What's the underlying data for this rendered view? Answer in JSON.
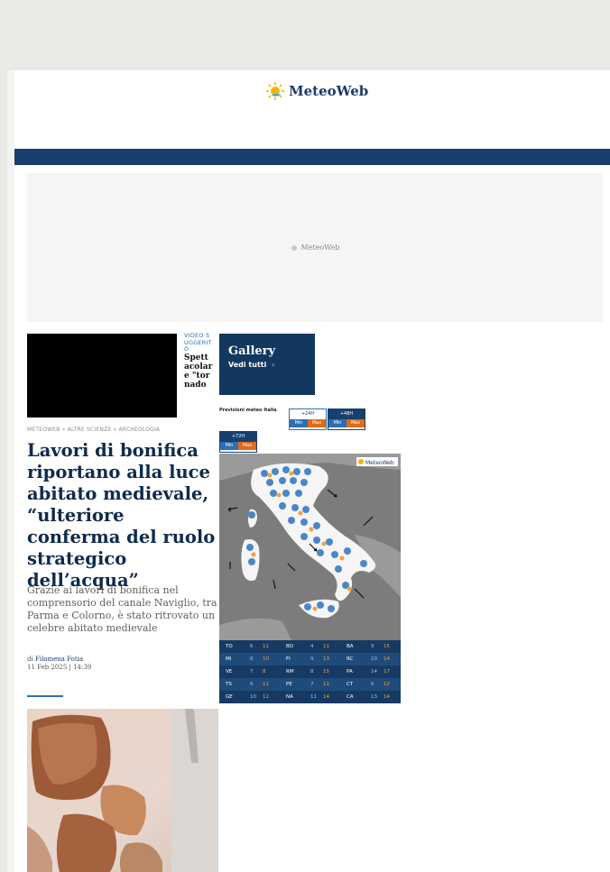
{
  "brand": {
    "name": "MeteoWeb",
    "ad_logo_text": "MeteoWeb",
    "map_logo_text": "MeteoWeb"
  },
  "video_widget": {
    "tag": "VIDEO SUGGERITO",
    "title": "Spettacolare \"tornado"
  },
  "gallery": {
    "title": "Gallery",
    "link": "Vedi tutti",
    "arrow": "›"
  },
  "breadcrumb": "METEOWEB » ALTRE SCIENZE » ARCHEOLOGIA",
  "article": {
    "headline": "Lavori di bonifica riportano alla luce abitato medievale, “ulteriore conferma del ruolo strategico dell’acqua”",
    "summary": "Grazie ai lavori di bonifica nel comprensorio del canale Naviglio, tra Parma e Colorno, è stato ritrovato un celebre abitato medievale",
    "byline_prefix": "di",
    "author": "Filomena Fotia",
    "date": "11 Feb 2025 | 14:39"
  },
  "forecast_widget": {
    "label": "Previsioni meteo Italia",
    "days": [
      {
        "label": "+24H",
        "min": "Min",
        "max": "Max"
      },
      {
        "label": "+48H",
        "min": "Min",
        "max": "Max"
      },
      {
        "label": "+72H",
        "min": "Min",
        "max": "Max"
      }
    ]
  },
  "forecast_table": [
    [
      {
        "city": "TO",
        "min": "6",
        "max": "11"
      },
      {
        "city": "BO",
        "min": "4",
        "max": "11"
      },
      {
        "city": "BA",
        "min": "9",
        "max": "15"
      }
    ],
    [
      {
        "city": "MI",
        "min": "8",
        "max": "10"
      },
      {
        "city": "FI",
        "min": "9",
        "max": "13"
      },
      {
        "city": "RC",
        "min": "10",
        "max": "14"
      }
    ],
    [
      {
        "city": "VE",
        "min": "7",
        "max": "8"
      },
      {
        "city": "RM",
        "min": "8",
        "max": "15"
      },
      {
        "city": "PA",
        "min": "14",
        "max": "17"
      }
    ],
    [
      {
        "city": "TS",
        "min": "6",
        "max": "11"
      },
      {
        "city": "PE",
        "min": "7",
        "max": "11"
      },
      {
        "city": "CT",
        "min": "6",
        "max": "12"
      }
    ],
    [
      {
        "city": "GE",
        "min": "10",
        "max": "12"
      },
      {
        "city": "NA",
        "min": "11",
        "max": "14"
      },
      {
        "city": "CA",
        "min": "13",
        "max": "14"
      }
    ]
  ],
  "colors": {
    "navy": "#17406e",
    "headline": "#0f2a4d",
    "accent_blue": "#2e6fb3",
    "accent_orange": "#e06a1b",
    "table_row_a": "#163a63",
    "table_row_b": "#1f4b7a"
  },
  "icons": [
    "sun-logo-icon",
    "wind-arrow-icon",
    "weather-icon"
  ]
}
